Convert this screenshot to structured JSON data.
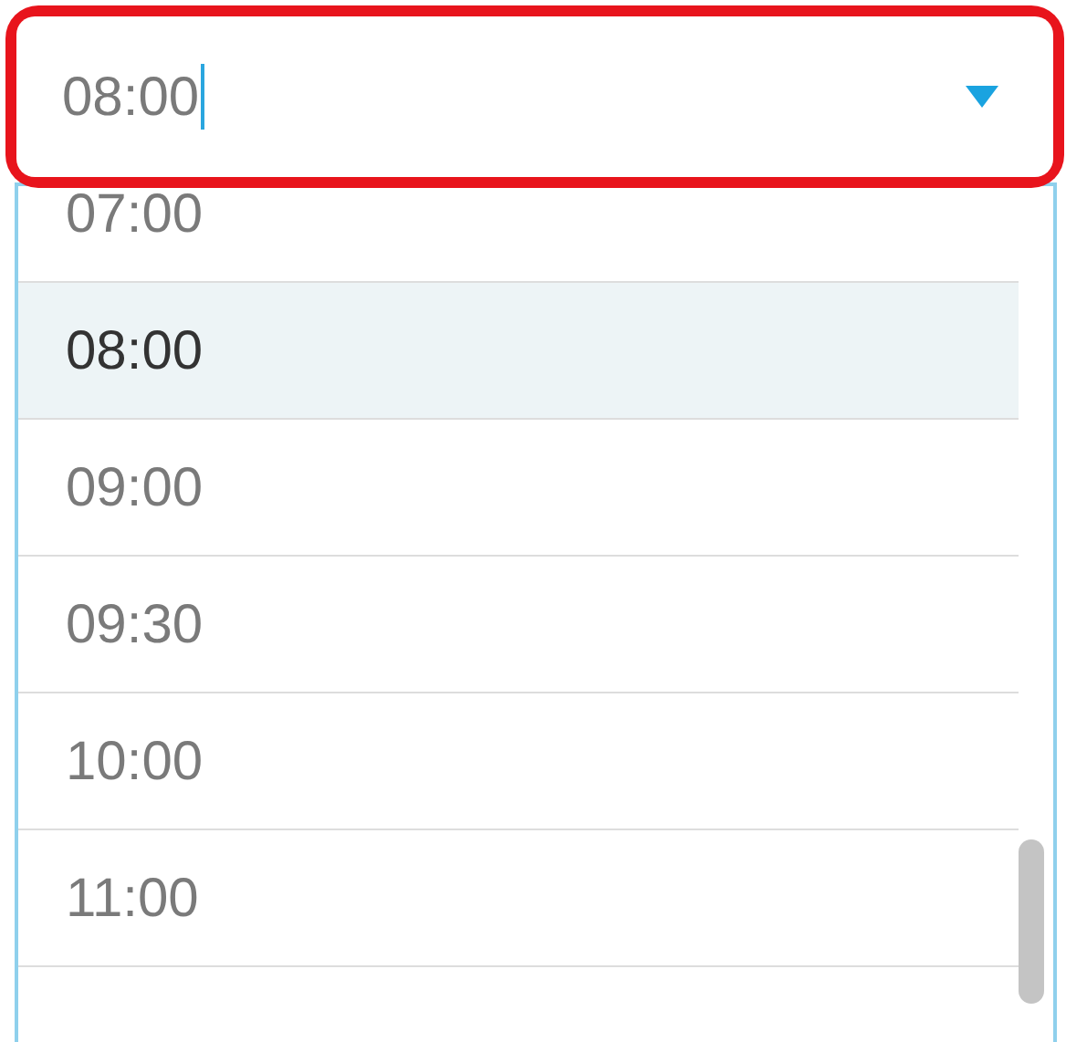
{
  "field": {
    "value": "08:00",
    "focused": true,
    "highlighted": true
  },
  "options": [
    {
      "label": "07:00",
      "selected": false
    },
    {
      "label": "08:00",
      "selected": true
    },
    {
      "label": "09:00",
      "selected": false
    },
    {
      "label": "09:30",
      "selected": false
    },
    {
      "label": "10:00",
      "selected": false
    },
    {
      "label": "11:00",
      "selected": false
    }
  ]
}
